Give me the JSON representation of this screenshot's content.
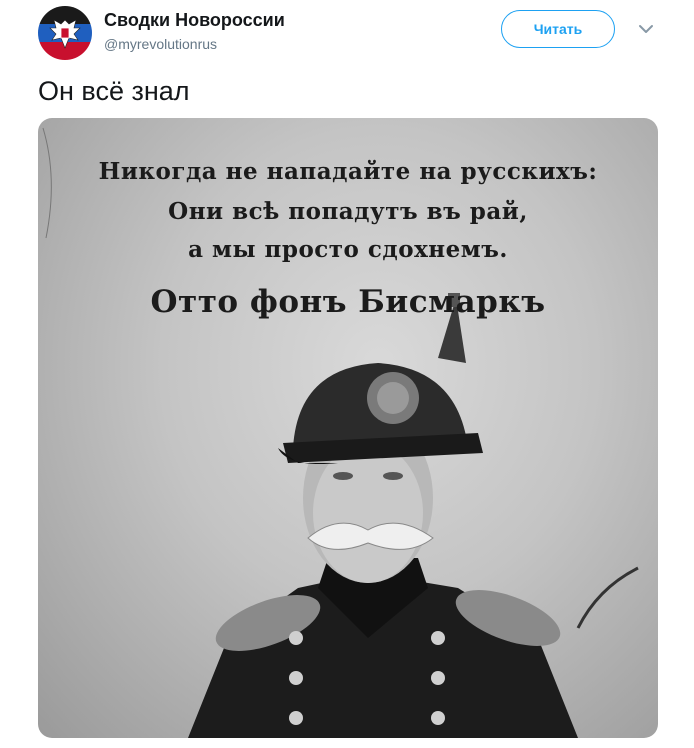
{
  "account": {
    "name": "Сводки Новороссии",
    "handle": "@myrevolutionrus",
    "avatar_icon": "double-headed-eagle-flag-icon"
  },
  "actions": {
    "follow_label": "Читать",
    "menu_icon": "chevron-down-icon"
  },
  "tweet": {
    "text": "Он всё знал"
  },
  "media": {
    "quote_lines": [
      "Никогда не нападайте на русскихъ:",
      "Они всѣ попадутъ въ рай,",
      "а мы просто сдохнемъ."
    ],
    "attribution": "Отто фонъ Бисмаркъ"
  },
  "colors": {
    "accent": "#1da1f2",
    "text": "#14171a",
    "muted": "#657786"
  }
}
